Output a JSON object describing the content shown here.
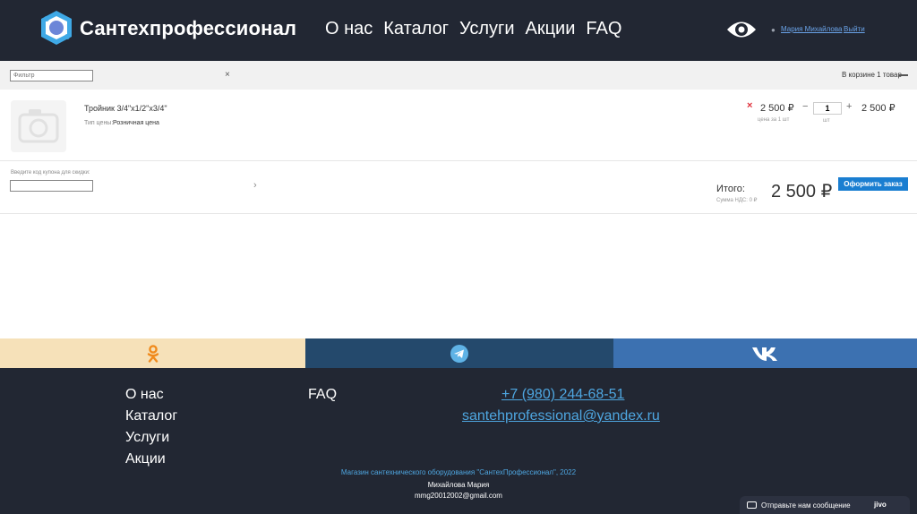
{
  "header": {
    "brand": "Сантехпрофессионал",
    "nav": [
      {
        "label": "О нас"
      },
      {
        "label": "Каталог"
      },
      {
        "label": "Услуги"
      },
      {
        "label": "Акции"
      },
      {
        "label": "FAQ"
      }
    ],
    "user_name": "Мария Михайлова",
    "logout": "Выйти",
    "icons": {
      "logo": "hexagon-logo-icon",
      "accessibility": "eye-icon",
      "user": "user-icon"
    }
  },
  "filter": {
    "placeholder": "Фильтр",
    "clear": "×",
    "cart_count": "В корзине 1 товар"
  },
  "cart": {
    "items": [
      {
        "name": "Тройник 3/4\"х1/2\"х3/4\"",
        "price_type_label": "Тип цены:",
        "price_type": "Розничная цена",
        "remove": "×",
        "unit_price": "2 500 ₽",
        "unit_price_note": "цена за 1 шт",
        "qty_minus": "−",
        "quantity": "1",
        "qty_unit": "шт",
        "qty_plus": "+",
        "line_total": "2 500 ₽"
      }
    ],
    "coupon_label": "Введите код купона для скидки:",
    "coupon_arrow": "›",
    "total_label": "Итого:",
    "vat_label": "Сумма НДС: 0 ₽",
    "total_value": "2 500 ₽",
    "checkout": "Оформить заказ"
  },
  "social": {
    "colors": {
      "ok": "#f6e1b9",
      "telegram": "#24496c",
      "vk": "#3c71b1"
    },
    "icons": [
      "odnoklassniki-icon",
      "telegram-icon",
      "vk-icon"
    ]
  },
  "footer": {
    "links": [
      {
        "label": "О нас"
      },
      {
        "label": "Каталог"
      },
      {
        "label": "Услуги"
      },
      {
        "label": "Акции"
      }
    ],
    "faq": "FAQ",
    "phone": "+7 (980) 244-68-51",
    "email": "santehprofessional@yandex.ru",
    "copyright": "Магазин сантехнического оборудования \"СантехПрофессионал\", 2022",
    "author": "Михайлова Мария",
    "author_email": "mmg20012002@gmail.com"
  },
  "chat": {
    "text": "Отправьте нам сообщение",
    "brand": "jivo"
  },
  "colors": {
    "header_bg": "#222733",
    "accent_blue": "#1a7ed1",
    "link_blue": "#4ea6e0",
    "remove_red": "#e0313c"
  }
}
